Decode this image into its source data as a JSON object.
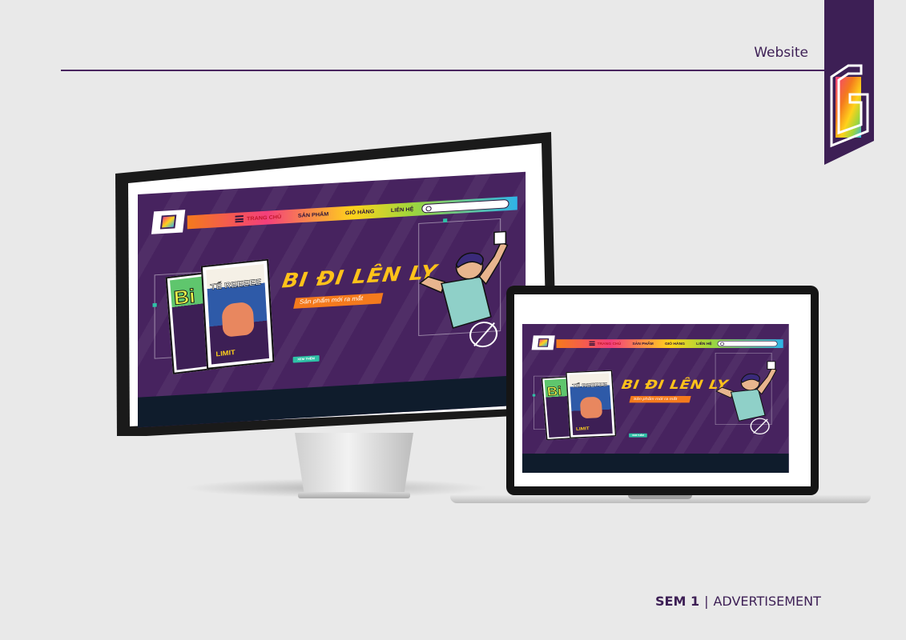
{
  "header": {
    "title": "Website"
  },
  "footer": {
    "series": "SEM 1",
    "separator": "|",
    "category": "ADVERTISEMENT"
  },
  "colors": {
    "brand_purple": "#3d1f55",
    "site_bg": "#47235f",
    "accent_yellow": "#ffc21a",
    "accent_orange": "#f47a1d",
    "accent_teal": "#2ec1a6"
  },
  "site": {
    "nav": [
      "TRANG CHỦ",
      "SẢN PHẨM",
      "GIỎ HÀNG",
      "LIÊN HỆ"
    ],
    "headline": "BI ĐI LÊN LY",
    "tagline": "Sản phẩm mới ra mắt",
    "cta": "XEM THÊM",
    "book_a_title": "Bi",
    "book_b_title": "TẾ REEEEE",
    "book_b_badge": "LIMIT"
  },
  "devices": [
    "imac-monitor",
    "laptop"
  ]
}
